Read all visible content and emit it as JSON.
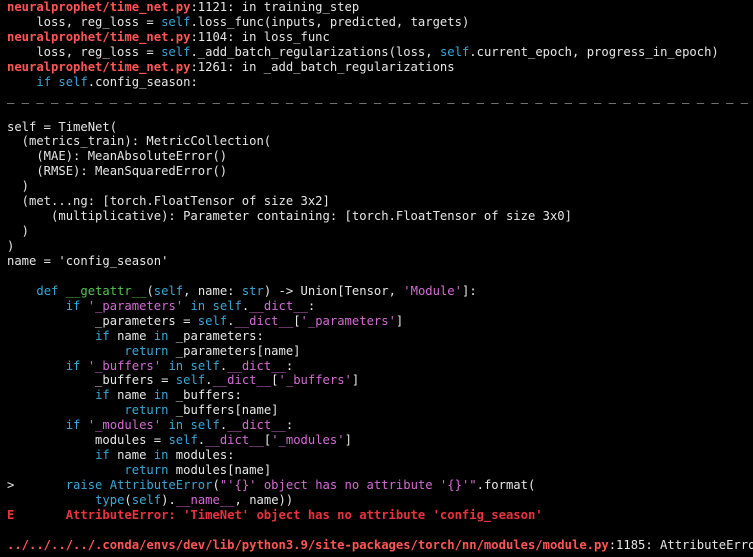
{
  "colors": {
    "background": "#000000",
    "default": "#e6e6e6",
    "red": "#ff5555",
    "redDim": "#e8323c",
    "cyan": "#3aa7d6",
    "magenta": "#d36bd3",
    "green": "#4fc44f"
  },
  "terminal": {
    "lines": [
      {
        "segments": [
          {
            "text": "neuralprophet/time_net.py",
            "c": "red",
            "b": true
          },
          {
            "text": ":1121: in training_step",
            "c": "default"
          }
        ]
      },
      {
        "segments": [
          {
            "text": "    loss, reg_loss = ",
            "c": "default"
          },
          {
            "text": "self",
            "c": "cyan"
          },
          {
            "text": ".loss_func(inputs, predicted, targets)",
            "c": "default"
          }
        ]
      },
      {
        "segments": [
          {
            "text": "neuralprophet/time_net.py",
            "c": "red",
            "b": true
          },
          {
            "text": ":1104: in loss_func",
            "c": "default"
          }
        ]
      },
      {
        "segments": [
          {
            "text": "    loss, reg_loss = ",
            "c": "default"
          },
          {
            "text": "self",
            "c": "cyan"
          },
          {
            "text": "._add_batch_regularizations(loss, ",
            "c": "default"
          },
          {
            "text": "self",
            "c": "cyan"
          },
          {
            "text": ".current_epoch, progress_in_epoch)",
            "c": "default"
          }
        ]
      },
      {
        "segments": [
          {
            "text": "neuralprophet/time_net.py",
            "c": "red",
            "b": true
          },
          {
            "text": ":1261: in _add_batch_regularizations",
            "c": "default"
          }
        ]
      },
      {
        "segments": [
          {
            "text": "    ",
            "c": "default"
          },
          {
            "text": "if",
            "c": "cyan"
          },
          {
            "text": " ",
            "c": "default"
          },
          {
            "text": "self",
            "c": "cyan"
          },
          {
            "text": ".config_season:",
            "c": "default"
          }
        ]
      },
      {
        "segments": [
          {
            "text": "_ _ _ _ _ _ _ _ _ _ _ _ _ _ _ _ _ _ _ _ _ _ _ _ _ _ _ _ _ _ _ _ _ _ _ _ _ _ _ _ _ _ _ _ _ _ _ _ _ _ _ _ _ _ _ _ _ _ _ _ _ _ _ _ _ _ _ _ _ _ _",
            "c": "default"
          }
        ]
      },
      {
        "segments": [
          {
            "text": "",
            "c": "default"
          }
        ]
      },
      {
        "segments": [
          {
            "text": "self = TimeNet(",
            "c": "default"
          }
        ]
      },
      {
        "segments": [
          {
            "text": "  (metrics_train): MetricCollection(",
            "c": "default"
          }
        ]
      },
      {
        "segments": [
          {
            "text": "    (MAE): MeanAbsoluteError()",
            "c": "default"
          }
        ]
      },
      {
        "segments": [
          {
            "text": "    (RMSE): MeanSquaredError()",
            "c": "default"
          }
        ]
      },
      {
        "segments": [
          {
            "text": "  )",
            "c": "default"
          }
        ]
      },
      {
        "segments": [
          {
            "text": "  (met...ng: [torch.FloatTensor of size 3x2]",
            "c": "default"
          }
        ]
      },
      {
        "segments": [
          {
            "text": "      (multiplicative): Parameter containing: [torch.FloatTensor of size 3x0]",
            "c": "default"
          }
        ]
      },
      {
        "segments": [
          {
            "text": "  )",
            "c": "default"
          }
        ]
      },
      {
        "segments": [
          {
            "text": ")",
            "c": "default"
          }
        ]
      },
      {
        "segments": [
          {
            "text": "name = 'config_season'",
            "c": "default"
          }
        ]
      },
      {
        "segments": [
          {
            "text": "",
            "c": "default"
          }
        ]
      },
      {
        "segments": [
          {
            "text": "    ",
            "c": "default"
          },
          {
            "text": "def",
            "c": "cyan"
          },
          {
            "text": " ",
            "c": "default"
          },
          {
            "text": "__getattr__",
            "c": "green"
          },
          {
            "text": "(",
            "c": "default"
          },
          {
            "text": "self",
            "c": "cyan"
          },
          {
            "text": ", name: ",
            "c": "default"
          },
          {
            "text": "str",
            "c": "cyan"
          },
          {
            "text": ") -> Union[Tensor, ",
            "c": "default"
          },
          {
            "text": "'Module'",
            "c": "magenta"
          },
          {
            "text": "]:",
            "c": "default"
          }
        ]
      },
      {
        "segments": [
          {
            "text": "        ",
            "c": "default"
          },
          {
            "text": "if",
            "c": "cyan"
          },
          {
            "text": " ",
            "c": "default"
          },
          {
            "text": "'_parameters'",
            "c": "magenta"
          },
          {
            "text": " ",
            "c": "default"
          },
          {
            "text": "in",
            "c": "cyan"
          },
          {
            "text": " ",
            "c": "default"
          },
          {
            "text": "self",
            "c": "cyan"
          },
          {
            "text": ".",
            "c": "default"
          },
          {
            "text": "__dict__",
            "c": "magenta"
          },
          {
            "text": ":",
            "c": "default"
          }
        ]
      },
      {
        "segments": [
          {
            "text": "            _parameters = ",
            "c": "default"
          },
          {
            "text": "self",
            "c": "cyan"
          },
          {
            "text": ".",
            "c": "default"
          },
          {
            "text": "__dict__",
            "c": "magenta"
          },
          {
            "text": "[",
            "c": "default"
          },
          {
            "text": "'_parameters'",
            "c": "magenta"
          },
          {
            "text": "]",
            "c": "default"
          }
        ]
      },
      {
        "segments": [
          {
            "text": "            ",
            "c": "default"
          },
          {
            "text": "if",
            "c": "cyan"
          },
          {
            "text": " name ",
            "c": "default"
          },
          {
            "text": "in",
            "c": "cyan"
          },
          {
            "text": " _parameters:",
            "c": "default"
          }
        ]
      },
      {
        "segments": [
          {
            "text": "                ",
            "c": "default"
          },
          {
            "text": "return",
            "c": "cyan"
          },
          {
            "text": " _parameters[name]",
            "c": "default"
          }
        ]
      },
      {
        "segments": [
          {
            "text": "        ",
            "c": "default"
          },
          {
            "text": "if",
            "c": "cyan"
          },
          {
            "text": " ",
            "c": "default"
          },
          {
            "text": "'_buffers'",
            "c": "magenta"
          },
          {
            "text": " ",
            "c": "default"
          },
          {
            "text": "in",
            "c": "cyan"
          },
          {
            "text": " ",
            "c": "default"
          },
          {
            "text": "self",
            "c": "cyan"
          },
          {
            "text": ".",
            "c": "default"
          },
          {
            "text": "__dict__",
            "c": "magenta"
          },
          {
            "text": ":",
            "c": "default"
          }
        ]
      },
      {
        "segments": [
          {
            "text": "            _buffers = ",
            "c": "default"
          },
          {
            "text": "self",
            "c": "cyan"
          },
          {
            "text": ".",
            "c": "default"
          },
          {
            "text": "__dict__",
            "c": "magenta"
          },
          {
            "text": "[",
            "c": "default"
          },
          {
            "text": "'_buffers'",
            "c": "magenta"
          },
          {
            "text": "]",
            "c": "default"
          }
        ]
      },
      {
        "segments": [
          {
            "text": "            ",
            "c": "default"
          },
          {
            "text": "if",
            "c": "cyan"
          },
          {
            "text": " name ",
            "c": "default"
          },
          {
            "text": "in",
            "c": "cyan"
          },
          {
            "text": " _buffers:",
            "c": "default"
          }
        ]
      },
      {
        "segments": [
          {
            "text": "                ",
            "c": "default"
          },
          {
            "text": "return",
            "c": "cyan"
          },
          {
            "text": " _buffers[name]",
            "c": "default"
          }
        ]
      },
      {
        "segments": [
          {
            "text": "        ",
            "c": "default"
          },
          {
            "text": "if",
            "c": "cyan"
          },
          {
            "text": " ",
            "c": "default"
          },
          {
            "text": "'_modules'",
            "c": "magenta"
          },
          {
            "text": " ",
            "c": "default"
          },
          {
            "text": "in",
            "c": "cyan"
          },
          {
            "text": " ",
            "c": "default"
          },
          {
            "text": "self",
            "c": "cyan"
          },
          {
            "text": ".",
            "c": "default"
          },
          {
            "text": "__dict__",
            "c": "magenta"
          },
          {
            "text": ":",
            "c": "default"
          }
        ]
      },
      {
        "segments": [
          {
            "text": "            modules = ",
            "c": "default"
          },
          {
            "text": "self",
            "c": "cyan"
          },
          {
            "text": ".",
            "c": "default"
          },
          {
            "text": "__dict__",
            "c": "magenta"
          },
          {
            "text": "[",
            "c": "default"
          },
          {
            "text": "'_modules'",
            "c": "magenta"
          },
          {
            "text": "]",
            "c": "default"
          }
        ]
      },
      {
        "segments": [
          {
            "text": "            ",
            "c": "default"
          },
          {
            "text": "if",
            "c": "cyan"
          },
          {
            "text": " name ",
            "c": "default"
          },
          {
            "text": "in",
            "c": "cyan"
          },
          {
            "text": " modules:",
            "c": "default"
          }
        ]
      },
      {
        "segments": [
          {
            "text": "                ",
            "c": "default"
          },
          {
            "text": "return",
            "c": "cyan"
          },
          {
            "text": " modules[name]",
            "c": "default"
          }
        ]
      },
      {
        "segments": [
          {
            "text": ">       ",
            "c": "default"
          },
          {
            "text": "raise",
            "c": "cyan"
          },
          {
            "text": " ",
            "c": "default"
          },
          {
            "text": "AttributeError",
            "c": "cyan"
          },
          {
            "text": "(",
            "c": "default"
          },
          {
            "text": "\"'{}' object has no attribute '{}'\"",
            "c": "magenta"
          },
          {
            "text": ".format(",
            "c": "default"
          }
        ]
      },
      {
        "segments": [
          {
            "text": "            ",
            "c": "default"
          },
          {
            "text": "type",
            "c": "cyan"
          },
          {
            "text": "(",
            "c": "default"
          },
          {
            "text": "self",
            "c": "cyan"
          },
          {
            "text": ").",
            "c": "default"
          },
          {
            "text": "__name__",
            "c": "magenta"
          },
          {
            "text": ", name))",
            "c": "default"
          }
        ]
      },
      {
        "segments": [
          {
            "text": "E       AttributeError: 'TimeNet' object has no attribute 'config_season'",
            "c": "redDim",
            "b": true
          }
        ]
      },
      {
        "segments": [
          {
            "text": "",
            "c": "default"
          }
        ]
      },
      {
        "segments": [
          {
            "text": "../../../../.conda/envs/dev/lib/python3.9/site-packages/torch/nn/modules/module.py",
            "c": "red",
            "b": true
          },
          {
            "text": ":1185: AttributeError",
            "c": "default"
          }
        ]
      }
    ]
  }
}
